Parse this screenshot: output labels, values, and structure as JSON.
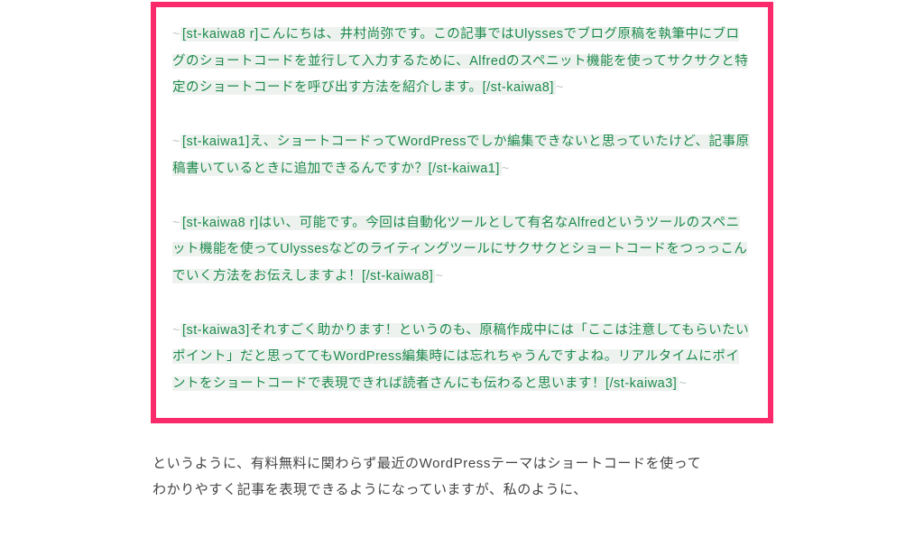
{
  "tilde": "~",
  "blocks": [
    {
      "open_tag": "[st-kaiwa8 r]",
      "body": "こんにちは、井村尚弥です。この記事ではUlyssesでブログ原稿を執筆中にブログのショートコードを並行して入力するために、Alfredのスペニット機能を使ってサクサクと特定のショートコードを呼び出す方法を紹介します。",
      "close_tag": "[/st-kaiwa8]"
    },
    {
      "open_tag": "[st-kaiwa1]",
      "body": "え、ショートコードってWordPressでしか編集できないと思っていたけど、記事原稿書いているときに追加できるんですか？",
      "close_tag": "[/st-kaiwa1]"
    },
    {
      "open_tag": "[st-kaiwa8 r]",
      "body": "はい、可能です。今回は自動化ツールとして有名なAlfredというツールのスペニット機能を使ってUlyssesなどのライティングツールにサクサクとショートコードをつっっこんでいく方法をお伝えしますよ！",
      "close_tag": "[/st-kaiwa8]"
    },
    {
      "open_tag": "[st-kaiwa3]",
      "body": "それすごく助かります！というのも、原稿作成中には「ここは注意してもらいたいポイント」だと思っててもWordPress編集時には忘れちゃうんですよね。リアルタイムにポイントをショートコードで表現できれば読者さんにも伝わると思います！",
      "close_tag": "[/st-kaiwa3]"
    }
  ],
  "below": {
    "line1": "というように、有料無料に関わらず最近のWordPressテーマはショートコードを使って",
    "line2": "わかりやすく記事を表現できるようになっていますが、私のように、"
  }
}
